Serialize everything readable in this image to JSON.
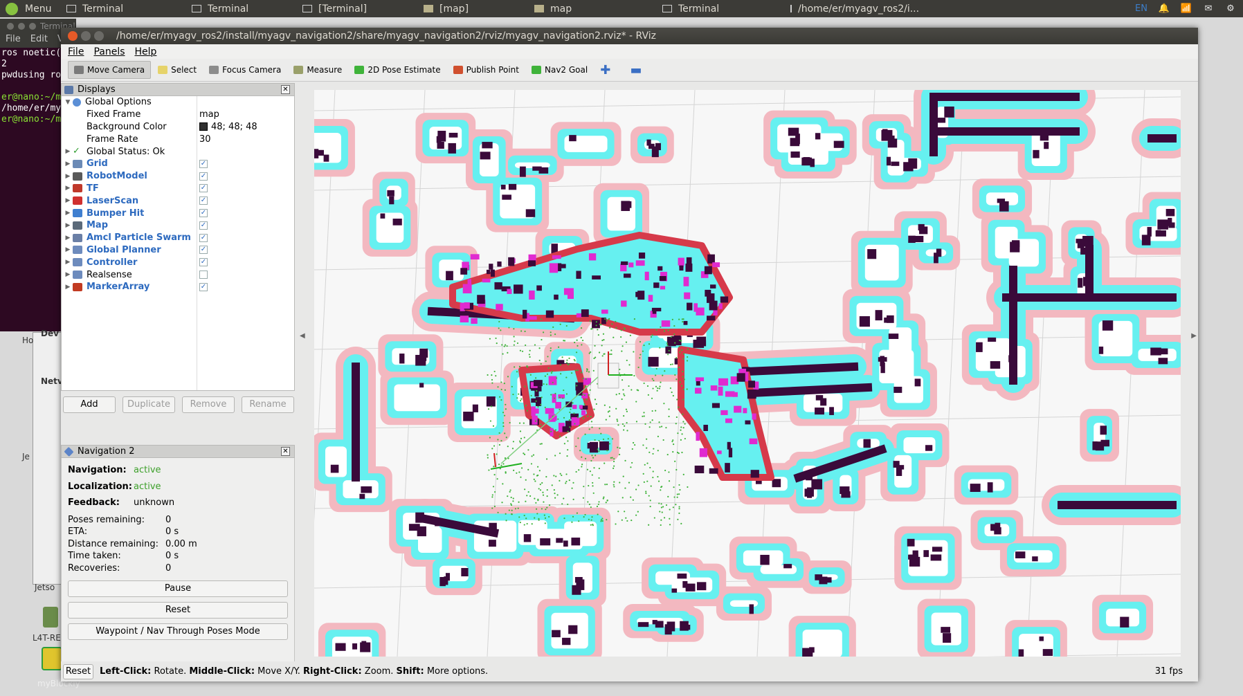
{
  "taskbar": {
    "menu_label": "Menu",
    "items": [
      {
        "label": "Terminal",
        "icon": "terminal-icon"
      },
      {
        "label": "Terminal",
        "icon": "terminal-icon"
      },
      {
        "label": "[Terminal]",
        "icon": "terminal-icon"
      },
      {
        "label": "[map]",
        "icon": "folder-icon"
      },
      {
        "label": "map",
        "icon": "folder-icon"
      },
      {
        "label": "Terminal",
        "icon": "terminal-icon"
      },
      {
        "label": "/home/er/myagv_ros2/i...",
        "icon": "rviz-icon"
      }
    ],
    "lang": "EN"
  },
  "background_terminal": {
    "title": "Terminal",
    "menu": [
      "File",
      "Edit",
      "V"
    ],
    "lines": [
      "ros noetic(",
      "2",
      "pwdusing ro",
      "",
      "er@nano:~/m",
      "/home/er/my",
      "er@nano:~/m"
    ]
  },
  "desktop": {
    "labels": [
      "Dev",
      "Netv",
      "Ho",
      "Je",
      "Jetso",
      "L4T-RE",
      "myBlockly"
    ]
  },
  "window": {
    "title": "/home/er/myagv_ros2/install/myagv_navigation2/share/myagv_navigation2/rviz/myagv_navigation2.rviz* - RViz"
  },
  "menubar": [
    "File",
    "Panels",
    "Help"
  ],
  "toolbar": [
    {
      "label": "Move Camera",
      "icon": "move-camera-icon",
      "color": "#7a7a7a"
    },
    {
      "label": "Select",
      "icon": "select-icon",
      "color": "#e6d36a"
    },
    {
      "label": "Focus Camera",
      "icon": "focus-camera-icon",
      "color": "#8c8c8c"
    },
    {
      "label": "Measure",
      "icon": "measure-icon",
      "color": "#9aa06a"
    },
    {
      "label": "2D Pose Estimate",
      "icon": "pose-estimate-icon",
      "color": "#3fb33a"
    },
    {
      "label": "Publish Point",
      "icon": "publish-point-icon",
      "color": "#d0502f"
    },
    {
      "label": "Nav2 Goal",
      "icon": "nav2-goal-icon",
      "color": "#3fb33a"
    }
  ],
  "displays": {
    "title": "Displays",
    "global_options": "Global Options",
    "props": [
      {
        "name": "Fixed Frame",
        "value": "map"
      },
      {
        "name": "Background Color",
        "value": "48; 48; 48"
      },
      {
        "name": "Frame Rate",
        "value": "30"
      }
    ],
    "global_status": "Global Status: Ok",
    "items": [
      {
        "name": "Grid",
        "checked": "✓",
        "color": "#6b8ab6"
      },
      {
        "name": "RobotModel",
        "checked": "✓",
        "color": "#5a5a5a"
      },
      {
        "name": "TF",
        "checked": "✓",
        "color": "#c0392b"
      },
      {
        "name": "LaserScan",
        "checked": "✓",
        "color": "#d0302f"
      },
      {
        "name": "Bumper Hit",
        "checked": "✓",
        "color": "#3f7fd0"
      },
      {
        "name": "Map",
        "checked": "✓",
        "color": "#5b6a7a"
      },
      {
        "name": "Amcl Particle Swarm",
        "checked": "✓",
        "color": "#6a7fa6"
      },
      {
        "name": "Global Planner",
        "checked": "✓",
        "color": "#6d8bbd"
      },
      {
        "name": "Controller",
        "checked": "✓",
        "color": "#6d8bbd"
      },
      {
        "name": "Realsense",
        "checked": "",
        "color": "#6d8bbd"
      },
      {
        "name": "MarkerArray",
        "checked": "✓",
        "color": "#c23b22"
      }
    ],
    "buttons": {
      "add": "Add",
      "duplicate": "Duplicate",
      "remove": "Remove",
      "rename": "Rename"
    }
  },
  "nav2": {
    "title": "Navigation 2",
    "navigation_label": "Navigation:",
    "navigation_value": "active",
    "localization_label": "Localization:",
    "localization_value": "active",
    "feedback_label": "Feedback:",
    "feedback_value": "unknown",
    "stats": [
      {
        "label": "Poses remaining:",
        "value": "0"
      },
      {
        "label": "ETA:",
        "value": "0 s"
      },
      {
        "label": "Distance remaining:",
        "value": "0.00 m"
      },
      {
        "label": "Time taken:",
        "value": "0 s"
      },
      {
        "label": "Recoveries:",
        "value": "0"
      }
    ],
    "buttons": [
      "Pause",
      "Reset",
      "Waypoint / Nav Through Poses Mode"
    ]
  },
  "statusbar": {
    "reset": "Reset",
    "hint_parts": [
      {
        "b": "Left-Click:",
        "t": " Rotate. "
      },
      {
        "b": "Middle-Click:",
        "t": " Move X/Y. "
      },
      {
        "b": "Right-Click:",
        "t": " Zoom. "
      },
      {
        "b": "Shift:",
        "t": " More options."
      }
    ],
    "fps": "31 fps"
  },
  "colors": {
    "obstacle": "#3a0a3a",
    "inflation": "#66f0f0",
    "cost_halo": "#f3b8c0",
    "high_cost": "#e02ad0",
    "critical": "#d63a4a",
    "particles": "#3fb33a"
  }
}
